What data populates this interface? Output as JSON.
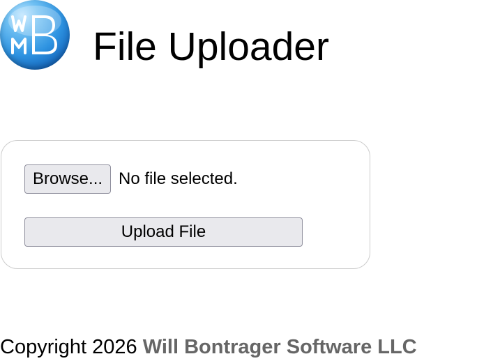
{
  "header": {
    "logo_icon": "wmb-logo-icon",
    "logo_text": "WMB",
    "title": "File Uploader"
  },
  "upload_form": {
    "browse_label": "Browse...",
    "file_status": "No file selected.",
    "upload_label": "Upload File"
  },
  "footer": {
    "copyright_prefix": "Copyright 2026",
    "company_name": "Will Bontrager Software LLC"
  },
  "colors": {
    "button_bg": "#e9e9ed",
    "button_border": "#8f8f9d",
    "card_border": "#cccccc",
    "company_link": "#666666",
    "logo_blue": "#2e93e1"
  }
}
